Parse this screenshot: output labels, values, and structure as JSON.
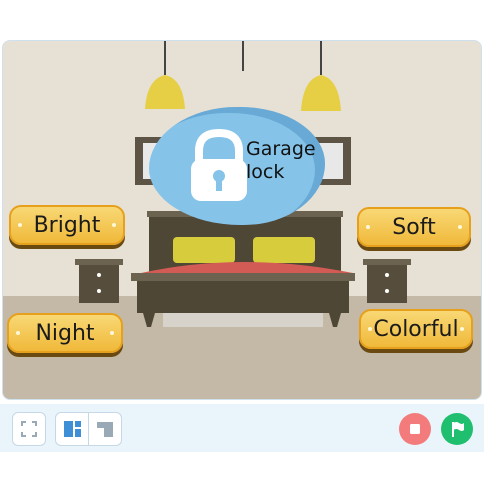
{
  "stage": {
    "buttons": {
      "garage_lock": "Garage\nlock",
      "bright": "Bright",
      "soft": "Soft",
      "night": "Night",
      "colorful": "Colorful"
    }
  },
  "toolbar": {
    "fullscreen_icon": "fullscreen-icon",
    "layout_normal_icon": "layout-normal-icon",
    "layout_small_icon": "layout-small-icon",
    "stop_icon": "stop-icon",
    "go_icon": "green-flag-icon"
  },
  "colors": {
    "stop": "#f47b7b",
    "go": "#1fbf6f",
    "pill": "#f4c653",
    "garage": "#86c3e8"
  }
}
